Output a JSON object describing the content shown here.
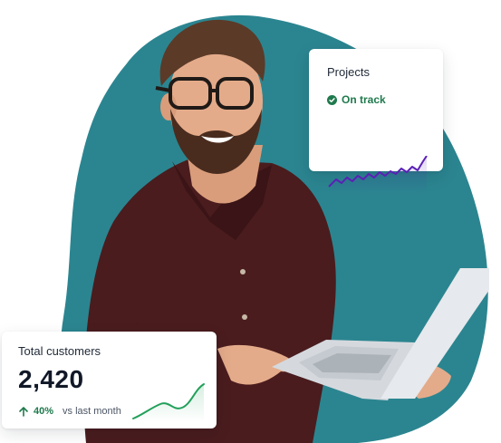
{
  "projects_card": {
    "title": "Projects",
    "status": "On track",
    "status_icon": "check-circle-icon",
    "status_color": "#1f7a4d",
    "sparkline_color": "#5b21b6"
  },
  "customers_card": {
    "title": "Total customers",
    "value": "2,420",
    "change_percent": "40%",
    "change_period": "vs last month",
    "change_icon": "arrow-up-icon",
    "change_color": "#1f7a4d",
    "sparkline_color": "#22a05a"
  },
  "colors": {
    "blob": "#2b8590",
    "shirt": "#4a1c1e",
    "skin": "#e4ab8a",
    "beard": "#4a2c1e",
    "laptop": "#e6e9ed"
  }
}
